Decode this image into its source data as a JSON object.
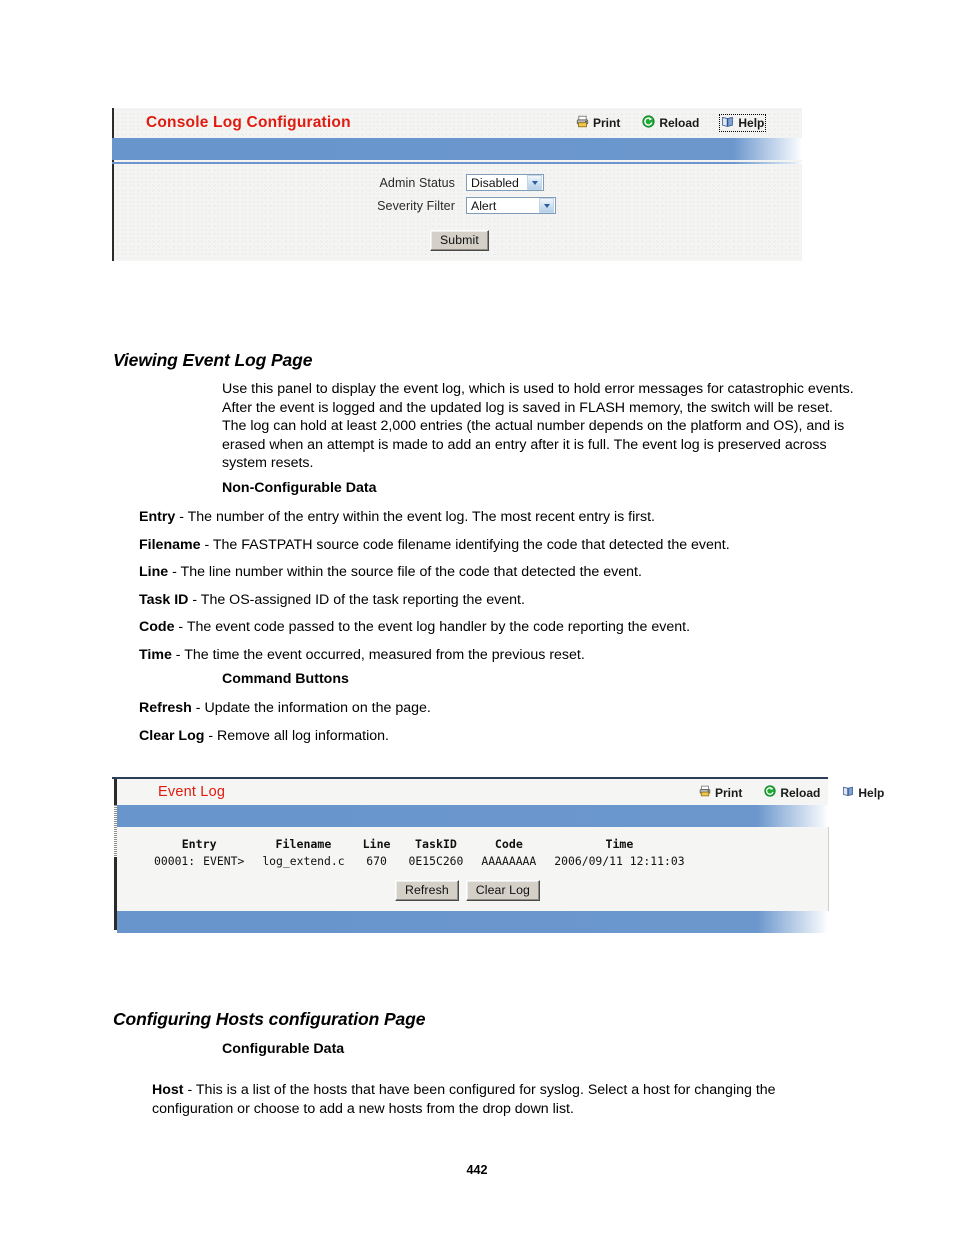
{
  "page": {
    "number": "442"
  },
  "console_log_panel": {
    "title": "Console Log Configuration",
    "toolbar": [
      {
        "label": "Print",
        "icon": "printer-icon"
      },
      {
        "label": "Reload",
        "icon": "reload-icon"
      },
      {
        "label": "Help",
        "icon": "help-book-icon",
        "focused": true
      }
    ],
    "fields": [
      {
        "label": "Admin Status",
        "value": "Disabled"
      },
      {
        "label": "Severity Filter",
        "value": "Alert"
      }
    ],
    "submit_label": "Submit"
  },
  "section_event_log": {
    "heading": "Viewing Event Log Page",
    "paragraph": "Use this panel to display the event log, which is used to hold error messages for catastrophic events. After the event is logged and the updated log is saved in FLASH memory, the switch will be reset. The log can hold at least 2,000 entries (the actual number depends on the platform and OS), and is erased when an attempt is made to add an entry after it is full. The event log is preserved across system resets.",
    "nonconfig_heading": "Non-Configurable Data",
    "definitions": [
      {
        "term": "Entry",
        "desc": " - The number of the entry within the event log. The most recent entry is first."
      },
      {
        "term": "Filename",
        "desc": " - The FASTPATH source code filename identifying the code that detected the event."
      },
      {
        "term": "Line",
        "desc": " - The line number within the source file of the code that detected the event."
      },
      {
        "term": "Task ID",
        "desc": " - The OS-assigned ID of the task reporting the event."
      },
      {
        "term": "Code",
        "desc": " - The event code passed to the event log handler by the code reporting the event."
      },
      {
        "term": "Time",
        "desc": " - The time the event occurred, measured from the previous reset."
      }
    ],
    "command_buttons_heading": "Command Buttons",
    "commands": [
      {
        "term": "Refresh",
        "desc": " - Update the information on the page."
      },
      {
        "term": "Clear Log",
        "desc": " - Remove all log information."
      }
    ]
  },
  "event_log_panel": {
    "title": "Event Log",
    "toolbar": [
      {
        "label": "Print",
        "icon": "printer-icon"
      },
      {
        "label": "Reload",
        "icon": "reload-icon"
      },
      {
        "label": "Help",
        "icon": "help-book-icon",
        "focused": false
      }
    ],
    "table": {
      "headers": [
        "Entry",
        "Filename",
        "Line",
        "TaskID",
        "Code",
        "Time"
      ],
      "rows": [
        {
          "entry_num": "00001:",
          "entry_tag": "EVENT>",
          "filename": "log_extend.c",
          "line": "670",
          "taskid": "0E15C260",
          "code": "AAAAAAAA",
          "time": "2006/09/11 12:11:03"
        }
      ]
    },
    "buttons": [
      {
        "label": "Refresh"
      },
      {
        "label": "Clear Log"
      }
    ]
  },
  "section_hosts": {
    "heading": "Configuring Hosts configuration Page",
    "configurable_heading": "Configurable Data",
    "host_term": "Host",
    "host_desc": " - This is a list of the hosts that have been configured for syslog. Select a host for changing the configuration or choose to add a new hosts from the drop down list."
  }
}
